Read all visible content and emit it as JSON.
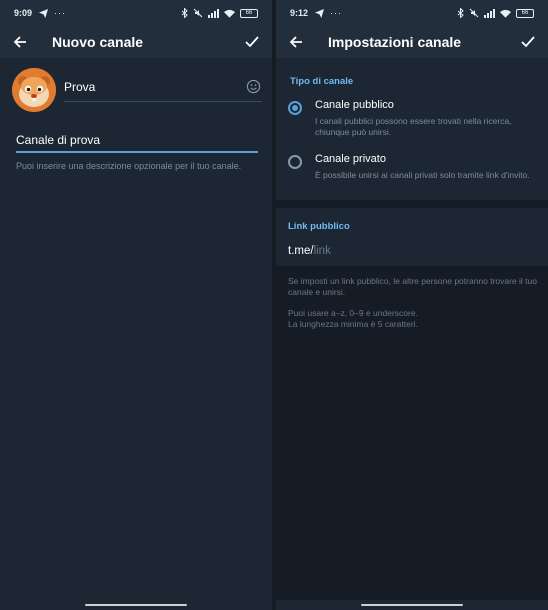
{
  "left": {
    "status": {
      "time": "9:09",
      "battery": "66"
    },
    "title": "Nuovo canale",
    "name_value": "Prova",
    "description_value": "Canale di prova",
    "description_hint": "Puoi inserire una descrizione opzionale per il tuo canale."
  },
  "right": {
    "status": {
      "time": "9:12",
      "battery": "66"
    },
    "title": "Impostazioni canale",
    "type_section_title": "Tipo di canale",
    "public_label": "Canale pubblico",
    "public_sub": "I canali pubblici possono essere trovati nella ricerca, chiunque può unirsi.",
    "private_label": "Canale privato",
    "private_sub": "È possibile unirsi ai canali privati solo tramite link d'invito.",
    "link_section_title": "Link pubblico",
    "link_prefix": "t.me/",
    "link_placeholder": "link",
    "hint1": "Se imposti un link pubblico, le altre persone potranno trovare il tuo canale e unirsi.",
    "hint2_line1": "Puoi usare a–z, 0–9 e underscore.",
    "hint2_line2": "La lunghezza minima è 5 caratteri."
  },
  "colors": {
    "background": "#1d2733",
    "header": "#232e3c",
    "accent": "#5a9fd9",
    "section_title": "#71baf3",
    "hint_text": "#7d8b99",
    "avatar": "#e07b2f"
  },
  "icons": {
    "back": "arrow-left-icon",
    "confirm": "check-icon",
    "emoji": "smile-icon",
    "telegram": "paper-plane-icon",
    "bluetooth": "bluetooth-icon",
    "wifi": "wifi-icon",
    "signal": "signal-icon"
  }
}
